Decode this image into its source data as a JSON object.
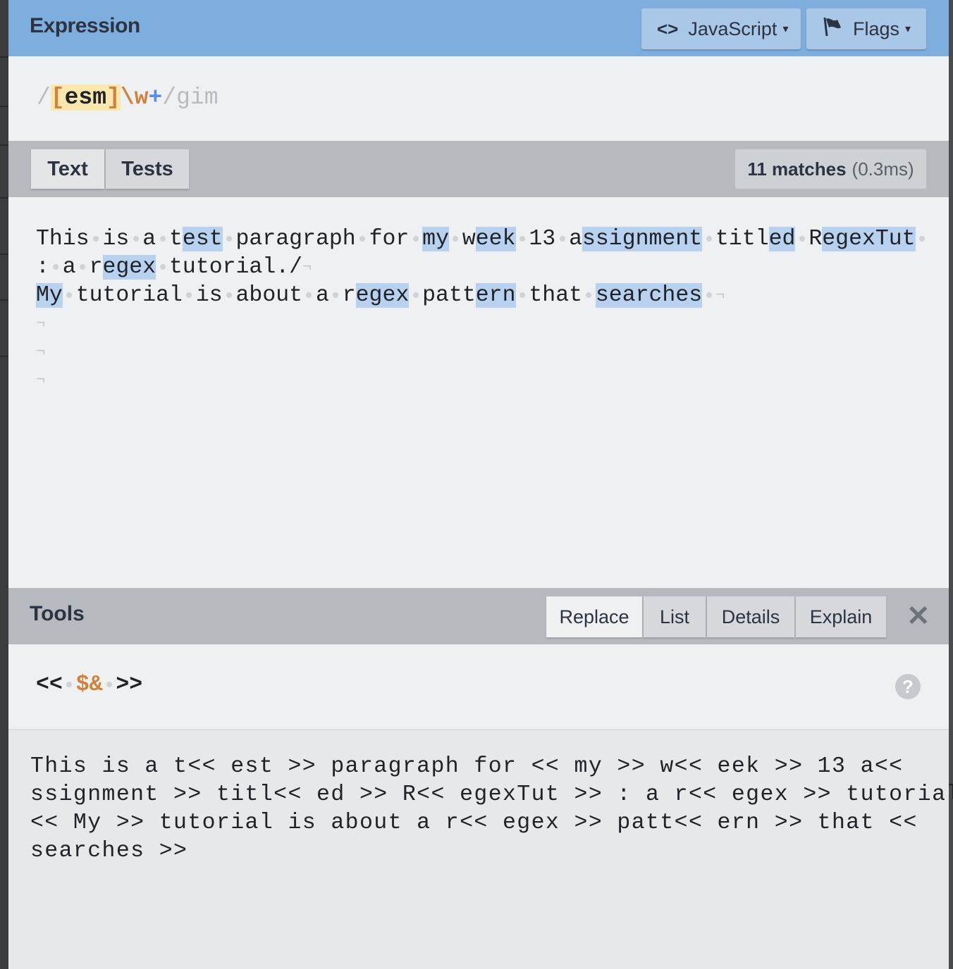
{
  "expression": {
    "title": "Expression",
    "language_button": "JavaScript",
    "flags_button": "Flags",
    "caret": "▾",
    "code_icon": "<>",
    "pattern": {
      "open_delim": "/",
      "set_open": "[",
      "set_chars": "esm",
      "set_close": "]",
      "escape": "\\w",
      "quantifier": "+",
      "close_delim": "/",
      "flags": "gim"
    }
  },
  "text_panel": {
    "tab_text": "Text",
    "tab_tests": "Tests",
    "matches_label": "11 matches",
    "time_label": "(0.3ms)",
    "newline_glyph": "¬"
  },
  "tools": {
    "title": "Tools",
    "tab_replace": "Replace",
    "tab_list": "List",
    "tab_details": "Details",
    "tab_explain": "Explain",
    "close_glyph": "✕",
    "help_glyph": "?",
    "replace_pattern": {
      "prefix": "<<",
      "substitution": "$&",
      "suffix": ">>"
    },
    "result_lines": [
      "This is a t<< est >> paragraph for << my >> w<< eek >> 13 a<<",
      "ssignment >> titl<< ed >> R<< egexTut >> : a r<< egex >> tutorial./",
      "<< My >> tutorial is about a r<< egex >> patt<< ern >> that <<",
      "searches >>"
    ]
  },
  "accent_colors": {
    "header_blue": "#7eaedd",
    "match_highlight": "#b8d1ef",
    "token_orange": "#d1823a",
    "quantifier_blue": "#5a8ee0"
  }
}
